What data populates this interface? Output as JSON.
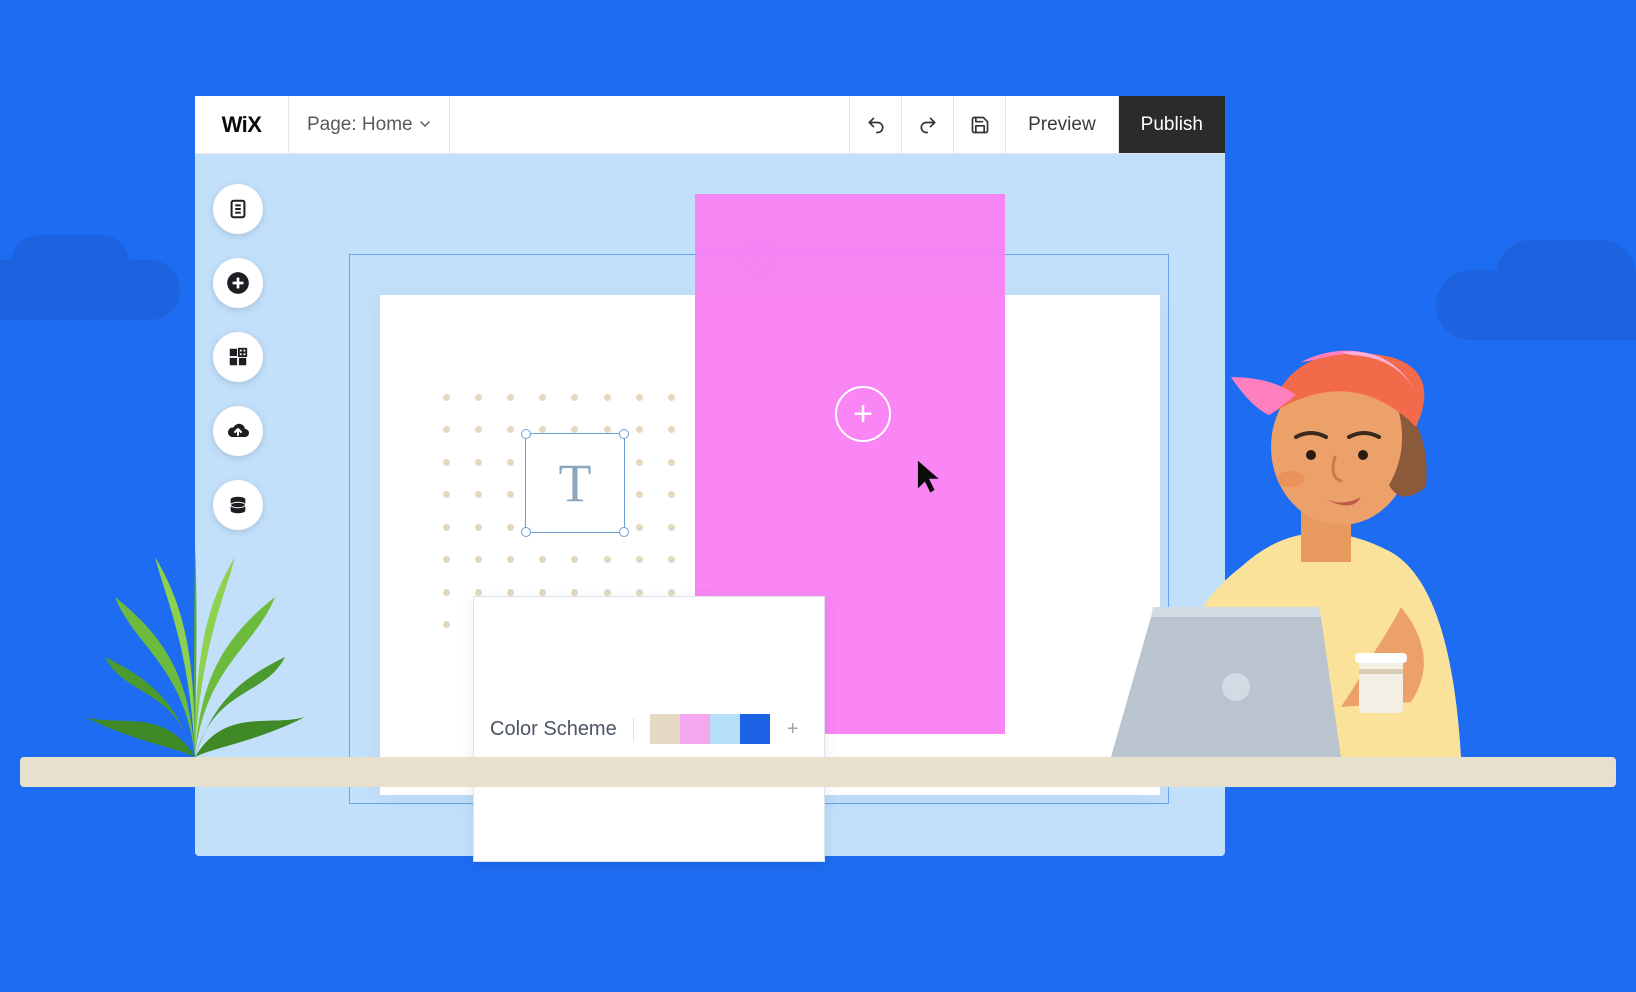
{
  "logo": "WiX",
  "topbar": {
    "page_label": "Page: Home",
    "preview_label": "Preview",
    "publish_label": "Publish"
  },
  "sidebar": {
    "icons": [
      "pages-icon",
      "add-icon",
      "appmarket-icon",
      "upload-icon",
      "data-icon"
    ]
  },
  "text_element": {
    "glyph": "T"
  },
  "color_scheme": {
    "label": "Color Scheme",
    "colors": [
      "#e6d9c3",
      "#f4a6ee",
      "#b7dff9",
      "#1c63e5"
    ]
  },
  "pink_add_glyph": "+",
  "swatch_add_glyph": "+"
}
